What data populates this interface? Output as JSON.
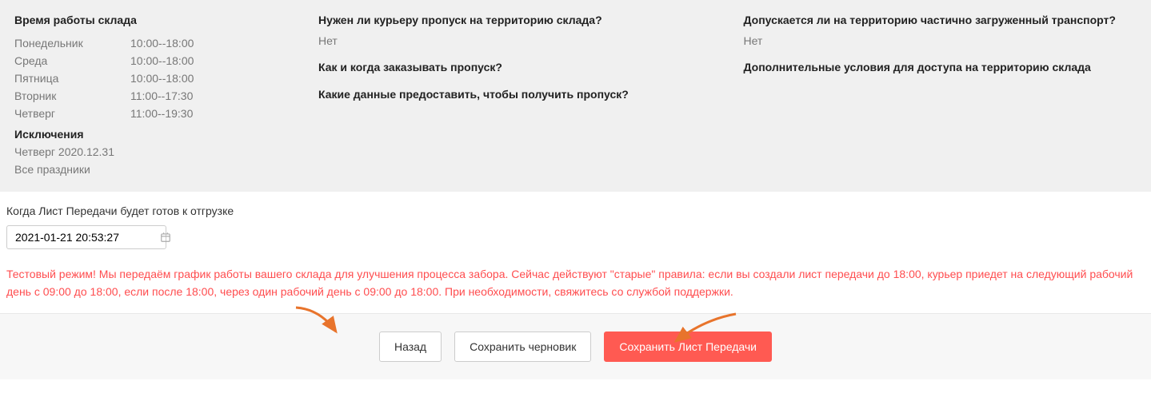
{
  "warehouse": {
    "schedule_title": "Время работы склада",
    "schedule": [
      {
        "day": "Понедельник",
        "hours": "10:00--18:00"
      },
      {
        "day": "Среда",
        "hours": "10:00--18:00"
      },
      {
        "day": "Пятница",
        "hours": "10:00--18:00"
      },
      {
        "day": "Вторник",
        "hours": "11:00--17:30"
      },
      {
        "day": "Четверг",
        "hours": "11:00--19:30"
      }
    ],
    "exceptions_title": "Исключения",
    "exceptions": [
      "Четверг 2020.12.31",
      "Все праздники"
    ]
  },
  "qa_col2": [
    {
      "q": "Нужен ли курьеру пропуск на территорию склада?",
      "a": "Нет"
    },
    {
      "q": "Как и когда заказывать пропуск?",
      "a": ""
    },
    {
      "q": "Какие данные предоставить, чтобы получить пропуск?",
      "a": ""
    }
  ],
  "qa_col3": [
    {
      "q": "Допускается ли на территорию частично загруженный транспорт?",
      "a": "Нет"
    },
    {
      "q": "Дополнительные условия для доступа на территорию склада",
      "a": ""
    }
  ],
  "ready": {
    "label": "Когда Лист Передачи будет готов к отгрузке",
    "value": "2021-01-21 20:53:27"
  },
  "warning": "Тестовый режим! Мы передаём график работы вашего склада для улучшения процесса забора. Сейчас действуют \"старые\" правила: если вы создали лист передачи до 18:00, курьер приедет на следующий рабочий день с 09:00 до 18:00, если после 18:00, через один рабочий день с 09:00 до 18:00. При необходимости, свяжитесь со службой поддержки.",
  "footer": {
    "back": "Назад",
    "save_draft": "Сохранить черновик",
    "save_sheet": "Сохранить Лист Передачи"
  }
}
